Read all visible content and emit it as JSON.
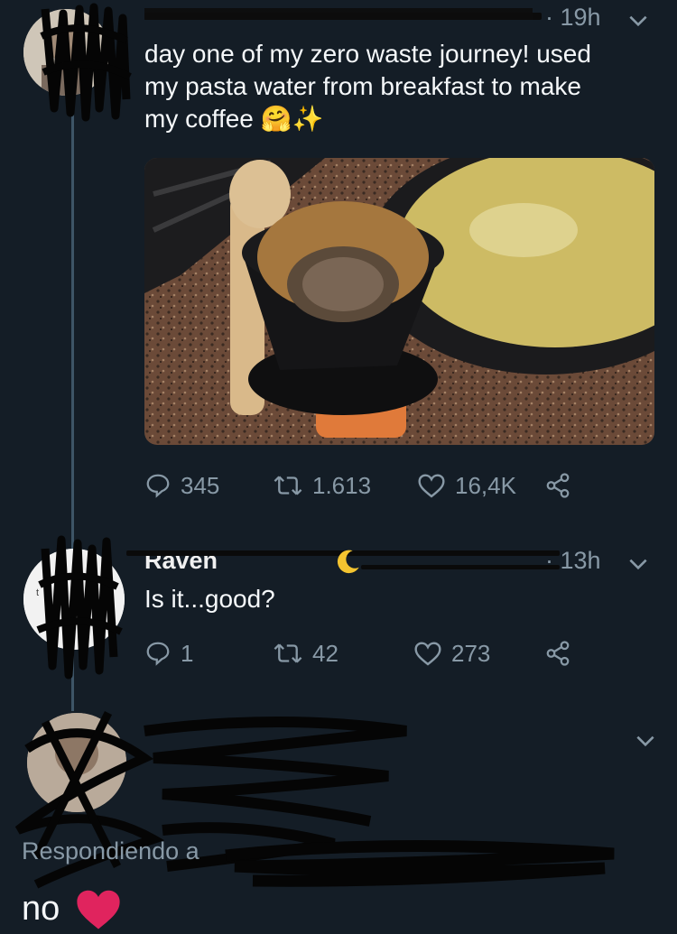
{
  "tweet1": {
    "time": "· 19h",
    "text_line1": "day one of my zero waste journey! used",
    "text_line2": "my pasta water from breakfast to make",
    "text_line3": "my coffee",
    "emoji": "🤗✨",
    "replies": "345",
    "retweets": "1.613",
    "likes": "16,4K"
  },
  "tweet2": {
    "name": "Raven",
    "time": "· 13h",
    "text": "Is it...good?",
    "replies": "1",
    "retweets": "42",
    "likes": "273"
  },
  "tweet3": {
    "replying_to": "Respondiendo a",
    "text": "no",
    "heart_color": "#e0245e"
  },
  "icons": [
    "reply-icon",
    "retweet-icon",
    "like-icon",
    "share-icon",
    "chevron-down-icon"
  ]
}
